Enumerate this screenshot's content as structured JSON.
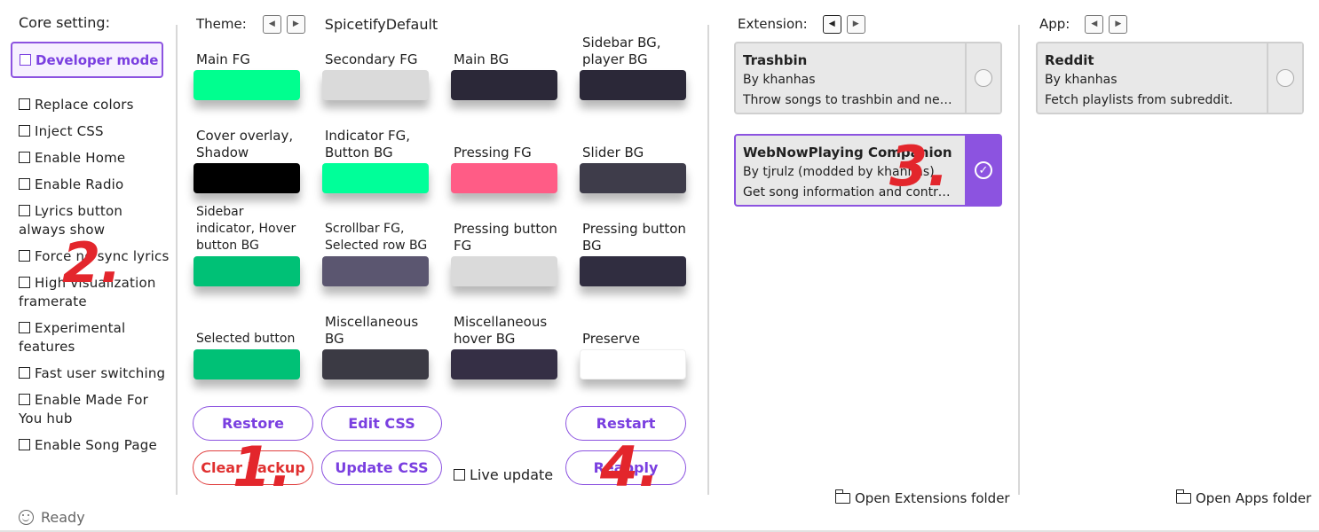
{
  "core": {
    "title": "Core setting:",
    "developer_mode": "Developer mode",
    "items": [
      "Replace colors",
      "Inject CSS",
      "Enable Home",
      "Enable Radio",
      "Lyrics button always show",
      "Force no sync lyrics",
      "High visualization framerate",
      "Experimental features",
      "Fast user switching",
      "Enable Made For You hub",
      "Enable Song Page"
    ]
  },
  "theme": {
    "title": "Theme:",
    "name": "SpicetifyDefault",
    "colors": [
      {
        "label": "Main FG",
        "color": "#00ff8f"
      },
      {
        "label": "Secondary FG",
        "color": "#dadada"
      },
      {
        "label": "Main BG",
        "color": "#2b2838"
      },
      {
        "label": "Sidebar BG, player BG",
        "color": "#2b2838"
      },
      {
        "label": "Cover overlay, Shadow",
        "color": "#000000"
      },
      {
        "label": "Indicator FG, Button BG",
        "color": "#00ff99"
      },
      {
        "label": "Pressing FG",
        "color": "#ff5c86"
      },
      {
        "label": "Slider BG",
        "color": "#3e3c4a"
      },
      {
        "label": "Sidebar indicator, Hover button BG",
        "color": "#00c176"
      },
      {
        "label": "Scrollbar FG, Selected row BG",
        "color": "#5b5670"
      },
      {
        "label": "Pressing button FG",
        "color": "#dadada"
      },
      {
        "label": "Pressing button BG",
        "color": "#302d40"
      },
      {
        "label": "Selected button",
        "color": "#00c176"
      },
      {
        "label": "Miscellaneous BG",
        "color": "#3b3a44"
      },
      {
        "label": "Miscellaneous hover BG",
        "color": "#352f45"
      },
      {
        "label": "Preserve",
        "color": "#ffffff"
      }
    ],
    "buttons": {
      "restore": "Restore",
      "edit_css": "Edit CSS",
      "restart": "Restart",
      "clear_backup": "Clear backup",
      "update_css": "Update CSS",
      "reapply": "Reapply",
      "live_update": "Live update"
    }
  },
  "extension": {
    "title": "Extension:",
    "cards": [
      {
        "name": "Trashbin",
        "author": "By khanhas",
        "desc": "Throw songs to trashbin and never hear them again.",
        "enabled": false
      },
      {
        "name": "WebNowPlaying Companion",
        "author": "By tjrulz (modded by khanhas)",
        "desc": "Get song information and control player.",
        "enabled": true
      }
    ],
    "open_folder": "Open Extensions folder"
  },
  "app": {
    "title": "App:",
    "cards": [
      {
        "name": "Reddit",
        "author": "By khanhas",
        "desc": "Fetch playlists from subreddit.",
        "enabled": false
      }
    ],
    "open_folder": "Open Apps folder"
  },
  "status": "Ready",
  "annotations": [
    "1.",
    "2.",
    "3.",
    "4."
  ],
  "icons": {
    "prev": "arrow-left-icon",
    "next": "arrow-right-icon",
    "folder": "folder-open-icon",
    "status": "smiley-icon",
    "check": "check-circle-icon"
  },
  "accent": "#8c53e0",
  "danger": "#e03030"
}
